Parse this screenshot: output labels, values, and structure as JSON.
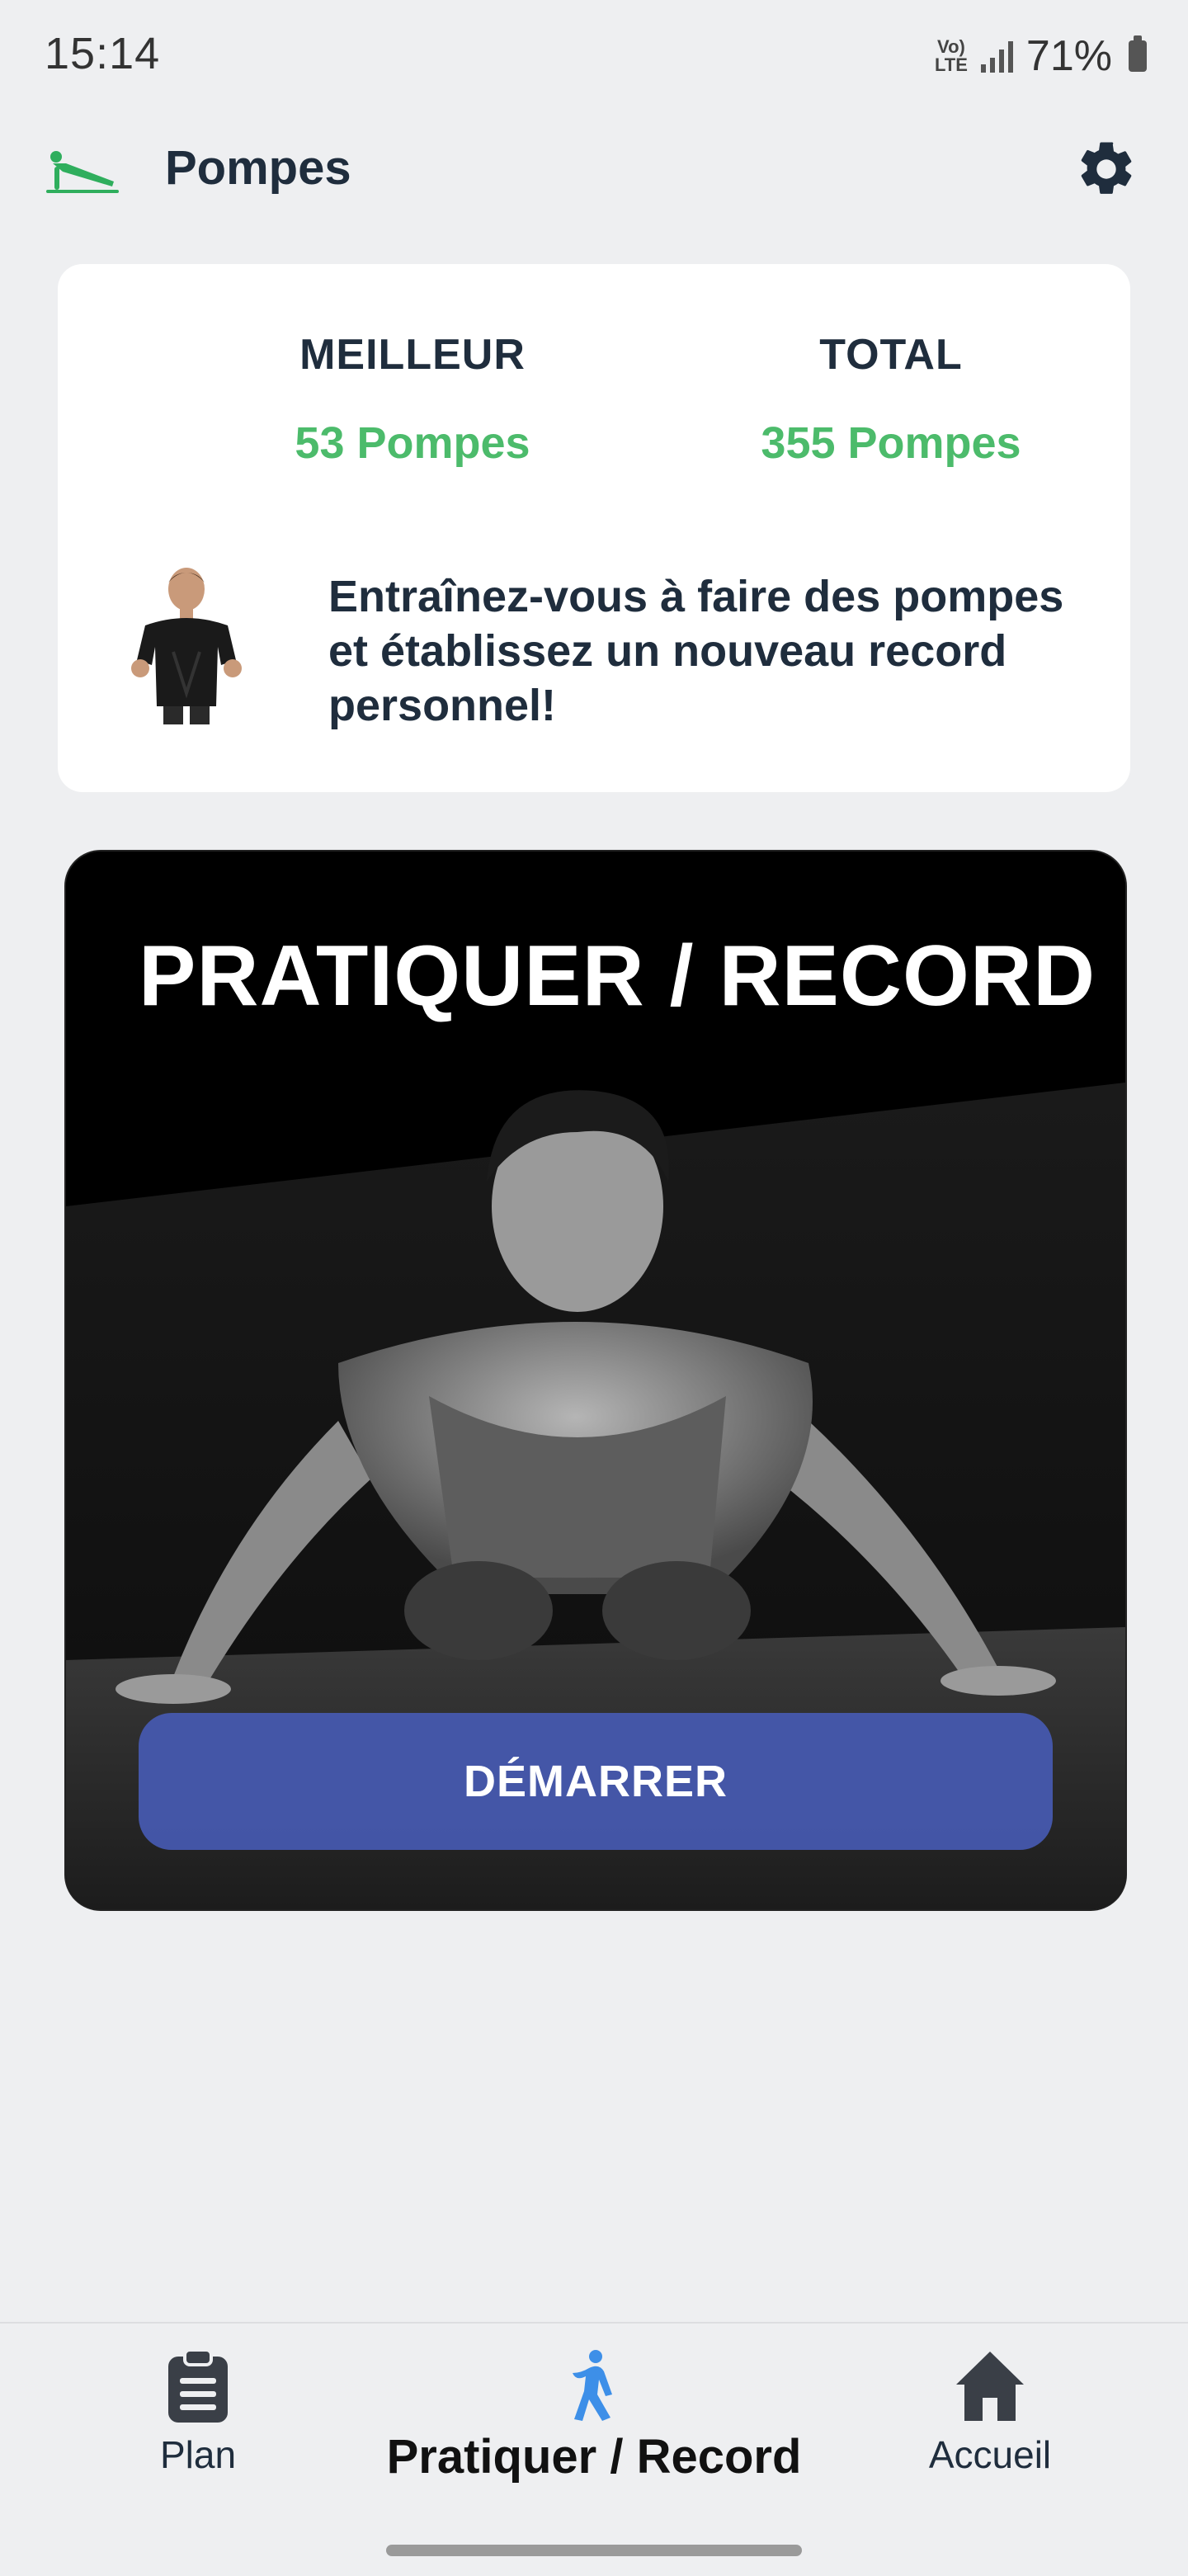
{
  "status_bar": {
    "time": "15:14",
    "network": "Vo) LTE",
    "battery": "71%"
  },
  "app_bar": {
    "title": "Pompes",
    "icons": {
      "app": "pushup-icon",
      "settings": "gear-icon"
    }
  },
  "stats": {
    "best_label": "MEILLEUR",
    "best_value": "53 Pompes",
    "total_label": "TOTAL",
    "total_value": "355 Pompes",
    "motivation": "Entraînez-vous à faire des pompes et établissez un nouveau record personnel!"
  },
  "practice": {
    "title": "PRATIQUER / RECORD",
    "start_label": "DÉMARRER"
  },
  "bottom_nav": {
    "items": [
      {
        "label": "Plan",
        "icon": "clipboard-icon"
      },
      {
        "label": "Pratiquer / Record",
        "icon": "exercise-person-icon",
        "active": true
      },
      {
        "label": "Accueil",
        "icon": "home-icon"
      }
    ]
  },
  "colors": {
    "accent_green": "#4cbb6b",
    "button_blue": "#4a5bb5",
    "active_nav_icon": "#3d8fe8",
    "text_dark": "#1f2d3d",
    "background": "#eeeff1"
  }
}
